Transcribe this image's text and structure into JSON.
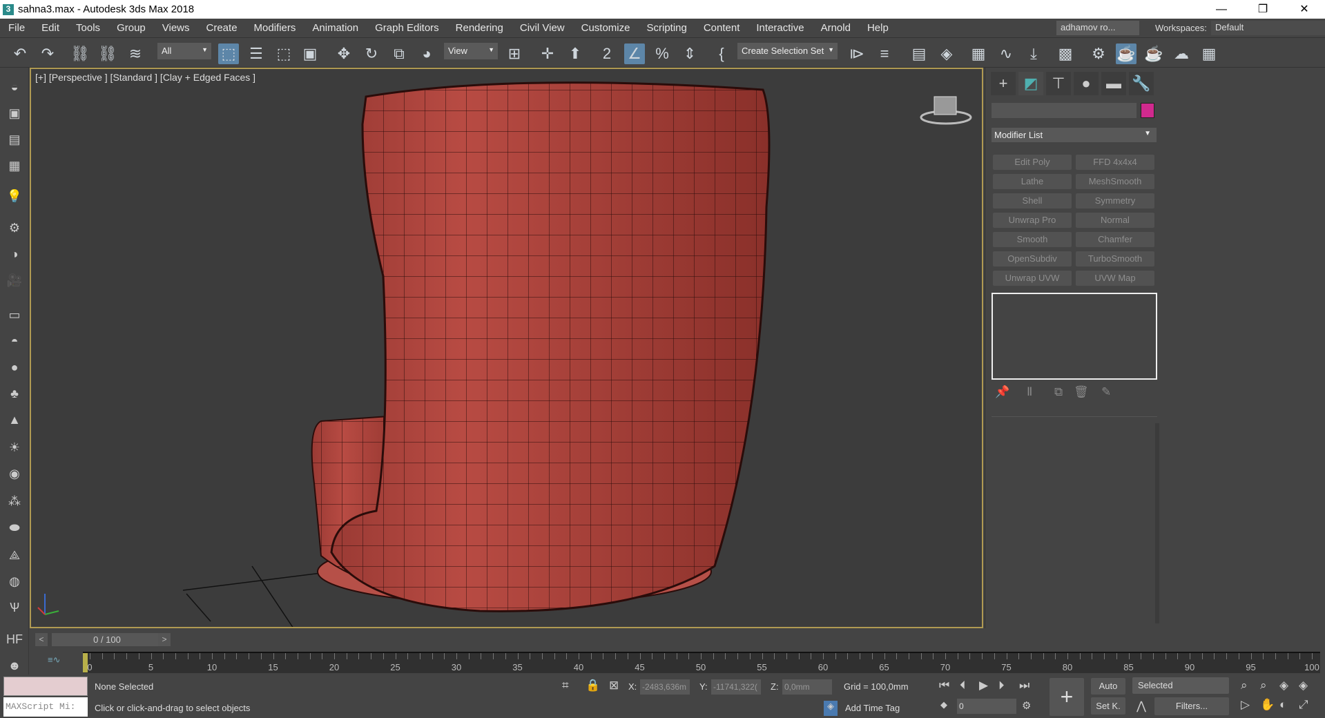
{
  "window": {
    "title": "sahna3.max - Autodesk 3ds Max 2018",
    "app_icon": "3",
    "minimize": "—",
    "maximize": "❐",
    "close": "✕"
  },
  "menu": [
    "File",
    "Edit",
    "Tools",
    "Group",
    "Views",
    "Create",
    "Modifiers",
    "Animation",
    "Graph Editors",
    "Rendering",
    "Civil View",
    "Customize",
    "Scripting",
    "Content",
    "Interactive",
    "Arnold",
    "Help"
  ],
  "user": "adhamov ro...",
  "workspaces": {
    "label": "Workspaces:",
    "value": "Default"
  },
  "toolbar": {
    "filter": "All",
    "ref_coord": "View",
    "selection_set": "Create Selection Set"
  },
  "viewport": {
    "label": "[+] [Perspective ] [Standard ] [Clay + Edged Faces ]",
    "accent": "#b09a52",
    "object_color": "#a8413a"
  },
  "command_panel": {
    "modifier_list": "Modifier List",
    "object_color": "#d02a8e",
    "modifier_buttons": [
      "Edit Poly",
      "FFD 4x4x4",
      "Lathe",
      "MeshSmooth",
      "Shell",
      "Symmetry",
      "Unwrap Pro",
      "Normal",
      "Smooth",
      "Chamfer",
      "OpenSubdiv",
      "TurboSmooth",
      "Unwrap UVW",
      "UVW Map"
    ]
  },
  "timeslider": {
    "value": "0 / 100",
    "prev": "<",
    "next": ">",
    "ticks": [
      "0",
      "5",
      "10",
      "15",
      "20",
      "25",
      "30",
      "35",
      "40",
      "45",
      "50",
      "55",
      "60",
      "65",
      "70",
      "75",
      "80",
      "85",
      "90",
      "95",
      "100"
    ]
  },
  "status": {
    "maxscript": "MAXScript Mi:",
    "selection": "None Selected",
    "prompt": "Click or click-and-drag to select objects",
    "x_label": "X:",
    "x": "-2483,636m",
    "y_label": "Y:",
    "y": "-11741,322(",
    "z_label": "Z:",
    "z": "0,0mm",
    "grid": "Grid = 100,0mm",
    "add_time_tag": "Add Time Tag",
    "auto": "Auto",
    "set_key": "Set K.",
    "key_filter": "Selected",
    "filters": "Filters...",
    "frame": "0"
  }
}
